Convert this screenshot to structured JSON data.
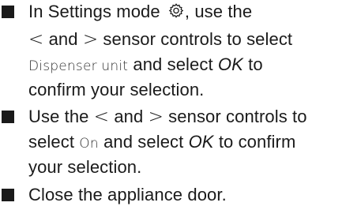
{
  "steps": [
    {
      "bullet": "square-bullet",
      "pre": "In Settings mode",
      "icon": "gear-icon",
      "mid1": ", use the",
      "less": "<",
      "and": "and",
      "greater": ">",
      "mid2": "sensor controls to select",
      "display_value": "Dispenser unit",
      "mid3": "and select",
      "ok": "OK",
      "post": "to confirm your selection."
    },
    {
      "bullet": "square-bullet",
      "pre": "Use the",
      "less": "<",
      "and": "and",
      "greater": ">",
      "mid2": "sensor controls to select",
      "display_value": "On",
      "mid3": "and select",
      "ok": "OK",
      "post": "to confirm your selection."
    },
    {
      "bullet": "square-bullet",
      "text": "Close the appliance door."
    }
  ]
}
